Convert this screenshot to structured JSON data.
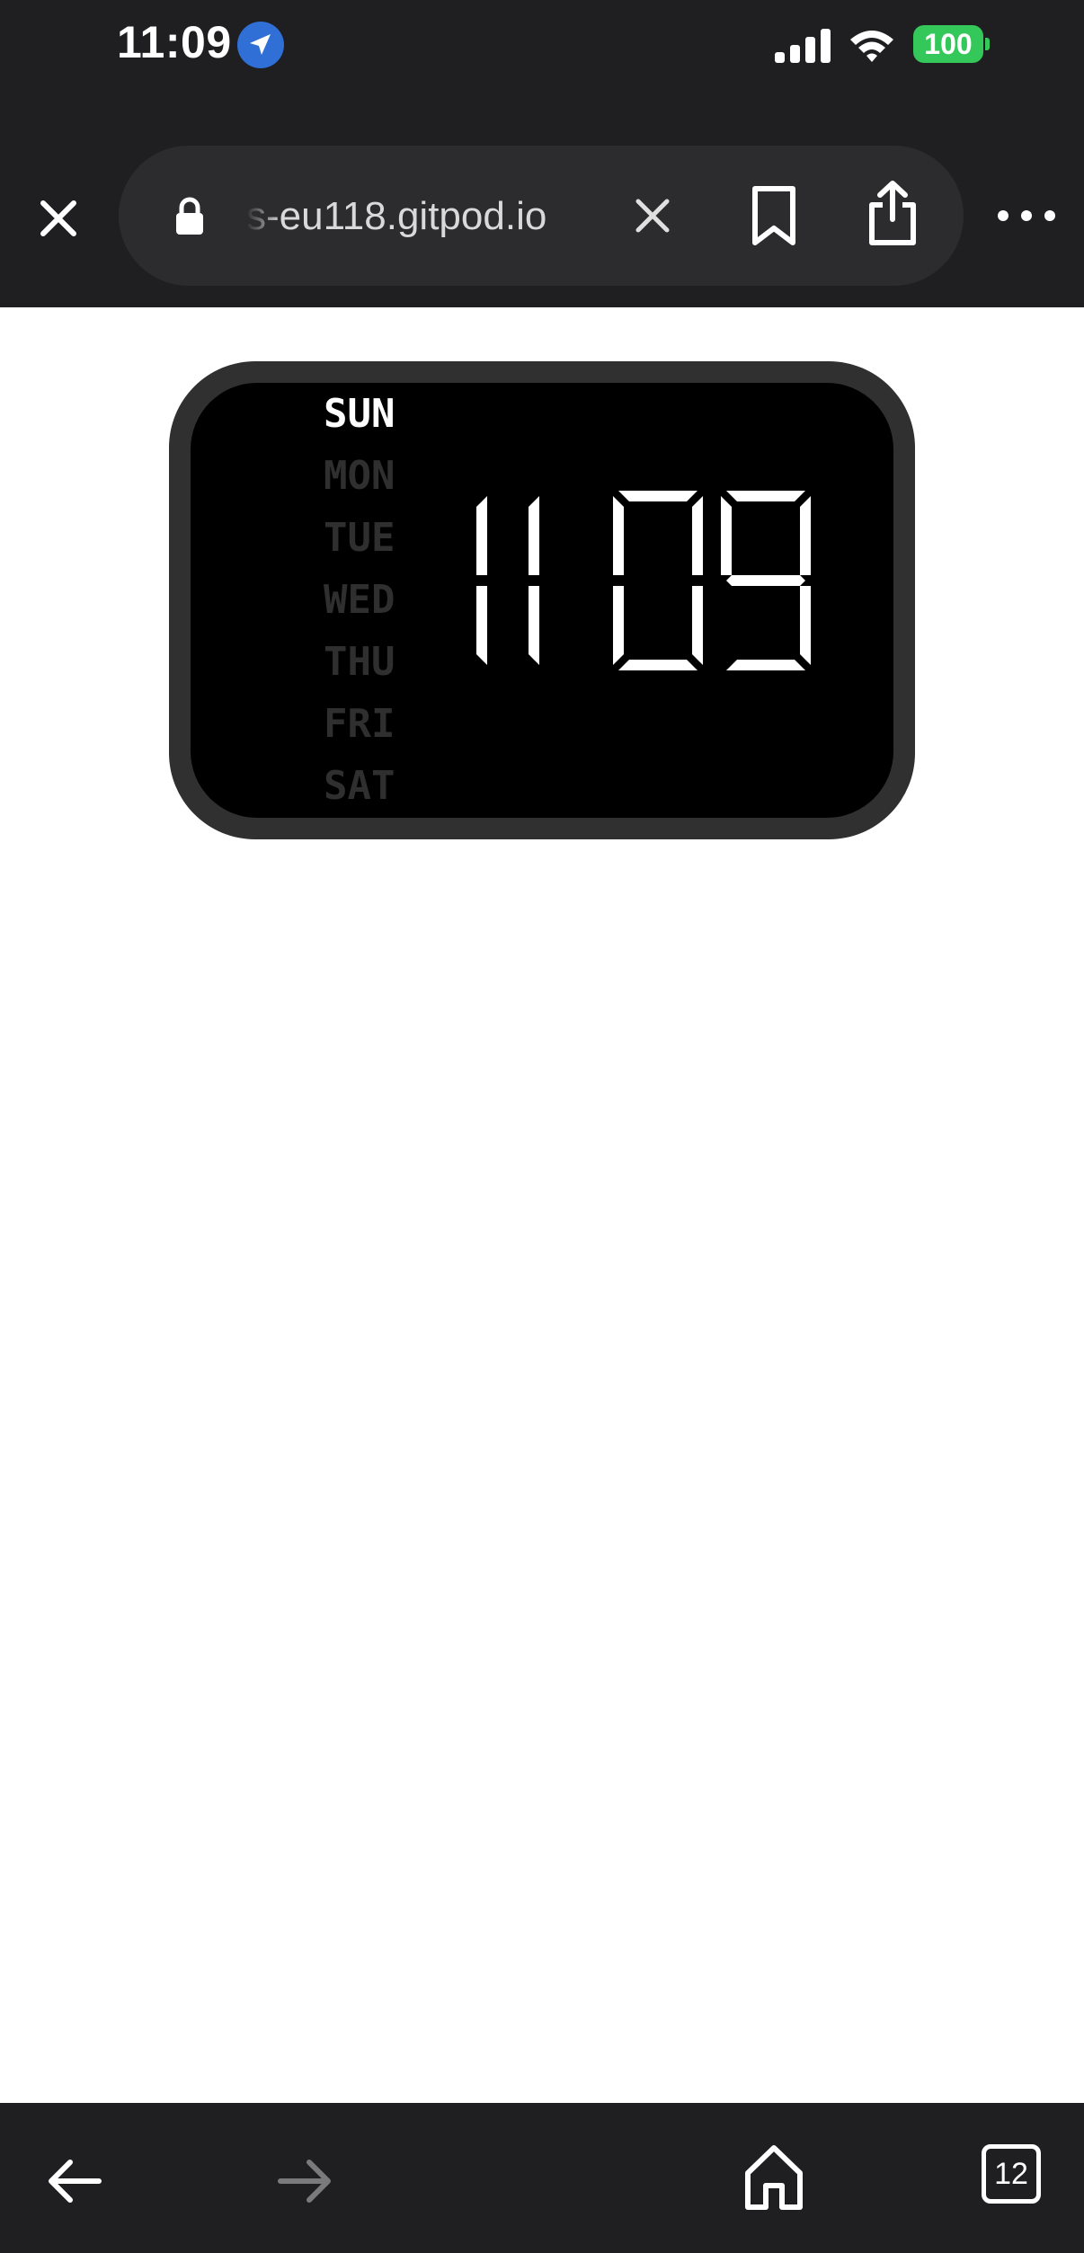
{
  "status_bar": {
    "time": "11:09",
    "battery_percent": "100",
    "battery_color": "#34c759",
    "icons": [
      "location-arrow-icon",
      "cellular-signal-icon",
      "wifi-icon",
      "battery-icon"
    ]
  },
  "browser": {
    "url_display": "s-eu118.gitpod.io",
    "icons": [
      "close-icon",
      "lock-icon",
      "clear-icon",
      "bookmark-icon",
      "share-icon",
      "more-icon"
    ]
  },
  "clock": {
    "days": [
      {
        "label": "SUN",
        "active": true
      },
      {
        "label": "MON",
        "active": false
      },
      {
        "label": "TUE",
        "active": false
      },
      {
        "label": "WED",
        "active": false
      },
      {
        "label": "THU",
        "active": false
      },
      {
        "label": "FRI",
        "active": false
      },
      {
        "label": "SAT",
        "active": false
      }
    ],
    "hour": "11",
    "minute": "09",
    "digit_color": "#ffffff",
    "inactive_day_color": "#2f2f2f"
  },
  "bottom_bar": {
    "tab_count": "12",
    "icons": [
      "back-arrow-icon",
      "forward-arrow-icon",
      "home-icon",
      "tabs-icon"
    ]
  }
}
